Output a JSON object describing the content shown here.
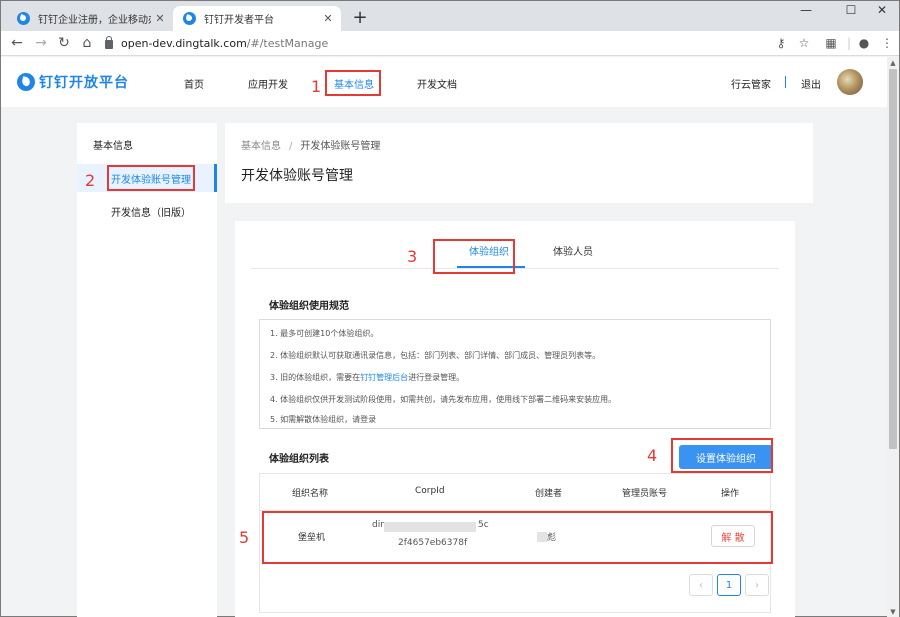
{
  "browser": {
    "tabs": [
      {
        "title": "钉钉企业注册，企业移动办公，..."
      },
      {
        "title": "钉钉开发者平台"
      }
    ],
    "new_tab": "+",
    "controls": {
      "minimize": "—",
      "maximize": "☐",
      "close": "✕"
    },
    "url_host": "open-dev.dingtalk.com",
    "url_path": "/#/testManage"
  },
  "header": {
    "logo_text": "钉钉开放平台",
    "nav": [
      "首页",
      "应用开发",
      "基本信息",
      "开发文档"
    ],
    "active_nav": "基本信息",
    "user_name": "行云管家",
    "logout": "退出"
  },
  "sidebar": {
    "title": "基本信息",
    "items": [
      {
        "label": "开发体验账号管理",
        "active": true
      },
      {
        "label": "开发信息（旧版）",
        "active": false
      }
    ]
  },
  "content": {
    "breadcrumb": [
      "基本信息",
      "开发体验账号管理"
    ],
    "breadcrumb_sep": "/",
    "title": "开发体验账号管理"
  },
  "card": {
    "tabs": [
      {
        "label": "体验组织",
        "active": true
      },
      {
        "label": "体验人员",
        "active": false
      }
    ],
    "rules_title": "体验组织使用规范",
    "rules": [
      {
        "text": "1. 最多可创建10个体验组织。"
      },
      {
        "text": "2. 体验组织默认可获取通讯录信息，包括：部门列表、部门详情、部门成员、管理员列表等。"
      },
      {
        "pre": "3. 旧的体验组织，需要在",
        "link": "钉钉管理后台",
        "post": "进行登录管理。"
      },
      {
        "text": "4. 体验组织仅供开发测试阶段使用，如需共创，请先发布应用，使用线下部署二维码来安装应用。"
      },
      {
        "text": "5. 如需解散体验组织，请登录"
      }
    ],
    "list_title": "体验组织列表",
    "set_button": "设置体验组织",
    "table": {
      "headers": [
        "组织名称",
        "CorpId",
        "创建者",
        "管理员账号",
        "操作"
      ],
      "rows": [
        {
          "name": "堡垒机",
          "corpid_line1_start": "din",
          "corpid_line1_end": "5c",
          "corpid_line2": "2f4657eb6378f",
          "creator": "彪",
          "admin": "",
          "action": "解 散"
        }
      ]
    },
    "pagination": {
      "prev": "‹",
      "current": "1",
      "next": "›"
    }
  },
  "annotations": [
    "1",
    "2",
    "3",
    "4",
    "5"
  ],
  "colors": {
    "accent": "#1f86e8",
    "annotation": "#e53935",
    "danger": "#e54d42"
  }
}
